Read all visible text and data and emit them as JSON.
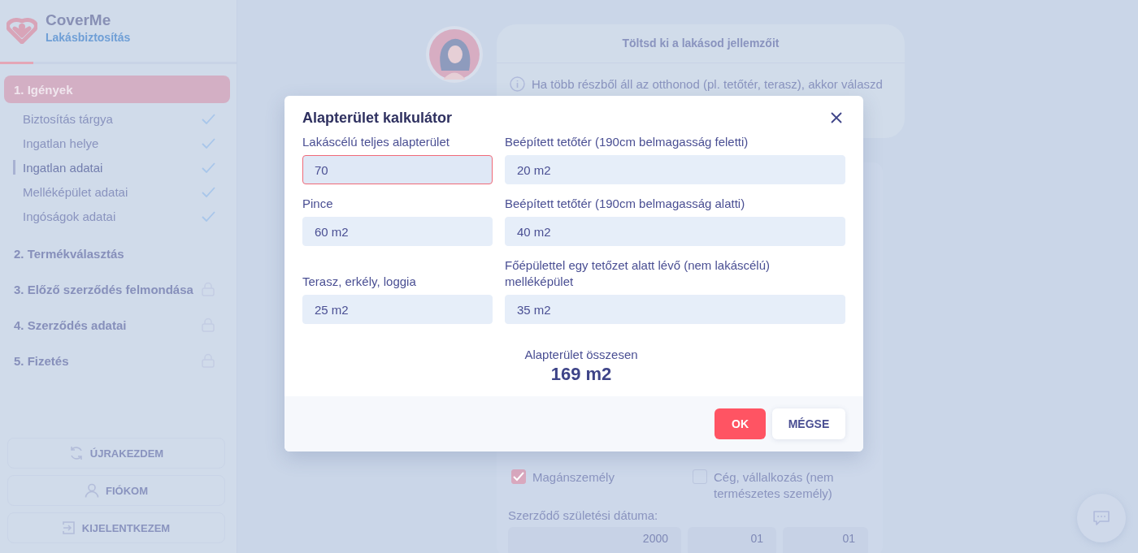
{
  "brand": {
    "name": "CoverMe",
    "product": "Lakásbiztosítás"
  },
  "steps": [
    {
      "label": "1. Igények",
      "selected": true,
      "locked": false,
      "children": [
        {
          "label": "Biztosítás tárgya",
          "done": true,
          "selected": false
        },
        {
          "label": "Ingatlan helye",
          "done": true,
          "selected": false
        },
        {
          "label": "Ingatlan adatai",
          "done": true,
          "selected": true
        },
        {
          "label": "Melléképület adatai",
          "done": true,
          "selected": false
        },
        {
          "label": "Ingóságok adatai",
          "done": true,
          "selected": false
        }
      ]
    },
    {
      "label": "2. Termékválasztás",
      "selected": false,
      "locked": false
    },
    {
      "label": "3. Előző szerződés felmondása",
      "selected": false,
      "locked": true
    },
    {
      "label": "4. Szerződés adatai",
      "selected": false,
      "locked": true
    },
    {
      "label": "5. Fizetés",
      "selected": false,
      "locked": true
    }
  ],
  "account_buttons": [
    {
      "kind": "restart",
      "label": "ÚJRAKEZDEM"
    },
    {
      "kind": "account",
      "label": "FIÓKOM"
    },
    {
      "kind": "logout",
      "label": "KIJELENTKEZEM"
    }
  ],
  "intro_card": {
    "title": "Töltsd ki a lakásod jellemzőit",
    "info": "Ha több részből áll az otthonod (pl. tetőtér, terasz), akkor válaszd"
  },
  "form": {
    "options": [
      {
        "label": "Magánszemély",
        "checked": true
      },
      {
        "label": "Cég, vállalkozás (nem természetes személy)",
        "checked": false
      }
    ],
    "birth_date_label": "Szerződő születési dátuma:",
    "birth_date": [
      "2000",
      "01",
      "01"
    ]
  },
  "modal": {
    "title": "Alapterület kalkulátor",
    "fields": [
      {
        "label": "Lakáscélú teljes alapterület",
        "value": "70",
        "focused": true
      },
      {
        "label": "Pince",
        "value": "60 m2",
        "focused": false
      },
      {
        "label": "Terasz, erkély, loggia",
        "value": "25 m2",
        "focused": false
      },
      {
        "label": "Beépített tetőtér (190cm belmagasság feletti)",
        "value": "20 m2",
        "focused": false
      },
      {
        "label": "Beépített tetőtér (190cm belmagasság alatti)",
        "value": "40 m2",
        "focused": false
      },
      {
        "label": "Főépülettel egy tetőzet alatt lévő (nem lakáscélú) melléképület",
        "value": "35 m2",
        "focused": false
      }
    ],
    "total_label": "Alapterület összesen",
    "total": "169 m2",
    "buttons": [
      {
        "kind": "primary",
        "label": "OK"
      },
      {
        "kind": "secondary",
        "label": "MÉGSE"
      }
    ]
  }
}
